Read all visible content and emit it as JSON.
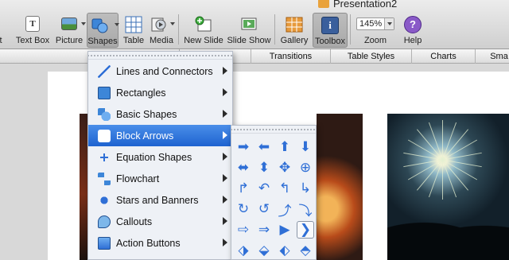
{
  "window": {
    "title": "Presentation2"
  },
  "toolbar": {
    "items": [
      {
        "key": "partial",
        "label": "t"
      },
      {
        "key": "textbox",
        "label": "Text Box"
      },
      {
        "key": "picture",
        "label": "Picture"
      },
      {
        "key": "shapes",
        "label": "Shapes"
      },
      {
        "key": "table",
        "label": "Table"
      },
      {
        "key": "media",
        "label": "Media"
      },
      {
        "key": "new_slide",
        "label": "New Slide"
      },
      {
        "key": "slide_show",
        "label": "Slide Show"
      },
      {
        "key": "gallery",
        "label": "Gallery"
      },
      {
        "key": "toolbox",
        "label": "Toolbox"
      },
      {
        "key": "zoom",
        "label": "Zoom"
      },
      {
        "key": "help",
        "label": "Help"
      }
    ],
    "zoom_value": "145%"
  },
  "ribbon": {
    "tabs": [
      "Transitions",
      "Table Styles",
      "Charts",
      "Sma"
    ]
  },
  "shapes_menu": {
    "items": [
      {
        "label": "Lines and Connectors",
        "icon": "line-icon",
        "selected": false
      },
      {
        "label": "Rectangles",
        "icon": "rectangle-icon",
        "selected": false
      },
      {
        "label": "Basic Shapes",
        "icon": "basic-shapes-icon",
        "selected": false
      },
      {
        "label": "Block Arrows",
        "icon": "block-arrows-icon",
        "selected": true
      },
      {
        "label": "Equation Shapes",
        "icon": "equation-icon",
        "selected": false
      },
      {
        "label": "Flowchart",
        "icon": "flowchart-icon",
        "selected": false
      },
      {
        "label": "Stars and Banners",
        "icon": "star-icon",
        "selected": false
      },
      {
        "label": "Callouts",
        "icon": "callout-icon",
        "selected": false
      },
      {
        "label": "Action Buttons",
        "icon": "action-button-icon",
        "selected": false
      }
    ]
  },
  "block_arrows_menu": {
    "cells": [
      {
        "glyph": "➡",
        "name": "right-arrow-icon"
      },
      {
        "glyph": "⬅",
        "name": "left-arrow-icon"
      },
      {
        "glyph": "⬆",
        "name": "up-arrow-icon"
      },
      {
        "glyph": "⬇",
        "name": "down-arrow-icon"
      },
      {
        "glyph": "⬌",
        "name": "left-right-arrow-icon"
      },
      {
        "glyph": "⬍",
        "name": "up-down-arrow-icon"
      },
      {
        "glyph": "✥",
        "name": "quad-arrow-icon"
      },
      {
        "glyph": "⊕",
        "name": "left-right-up-arrow-icon"
      },
      {
        "glyph": "↱",
        "name": "bent-arrow-icon"
      },
      {
        "glyph": "↶",
        "name": "u-turn-arrow-icon"
      },
      {
        "glyph": "↰",
        "name": "left-up-arrow-icon"
      },
      {
        "glyph": "↳",
        "name": "bent-up-arrow-icon"
      },
      {
        "glyph": "↻",
        "name": "curved-right-arrow-icon"
      },
      {
        "glyph": "↺",
        "name": "curved-left-arrow-icon"
      },
      {
        "glyph": "⤴",
        "name": "curved-up-arrow-icon"
      },
      {
        "glyph": "⤵",
        "name": "curved-down-arrow-icon"
      },
      {
        "glyph": "⇨",
        "name": "striped-right-arrow-icon"
      },
      {
        "glyph": "⇒",
        "name": "notched-right-arrow-icon"
      },
      {
        "glyph": "▶",
        "name": "pentagon-arrow-icon"
      },
      {
        "glyph": "❯",
        "name": "chevron-arrow-icon"
      },
      {
        "glyph": "⬗",
        "name": "right-arrow-callout-icon"
      },
      {
        "glyph": "⬙",
        "name": "down-arrow-callout-icon"
      },
      {
        "glyph": "⬖",
        "name": "left-arrow-callout-icon"
      },
      {
        "glyph": "⬘",
        "name": "up-arrow-callout-icon"
      }
    ]
  },
  "colors": {
    "selection": "#1e63d0",
    "arrow": "#2f6fd6"
  }
}
